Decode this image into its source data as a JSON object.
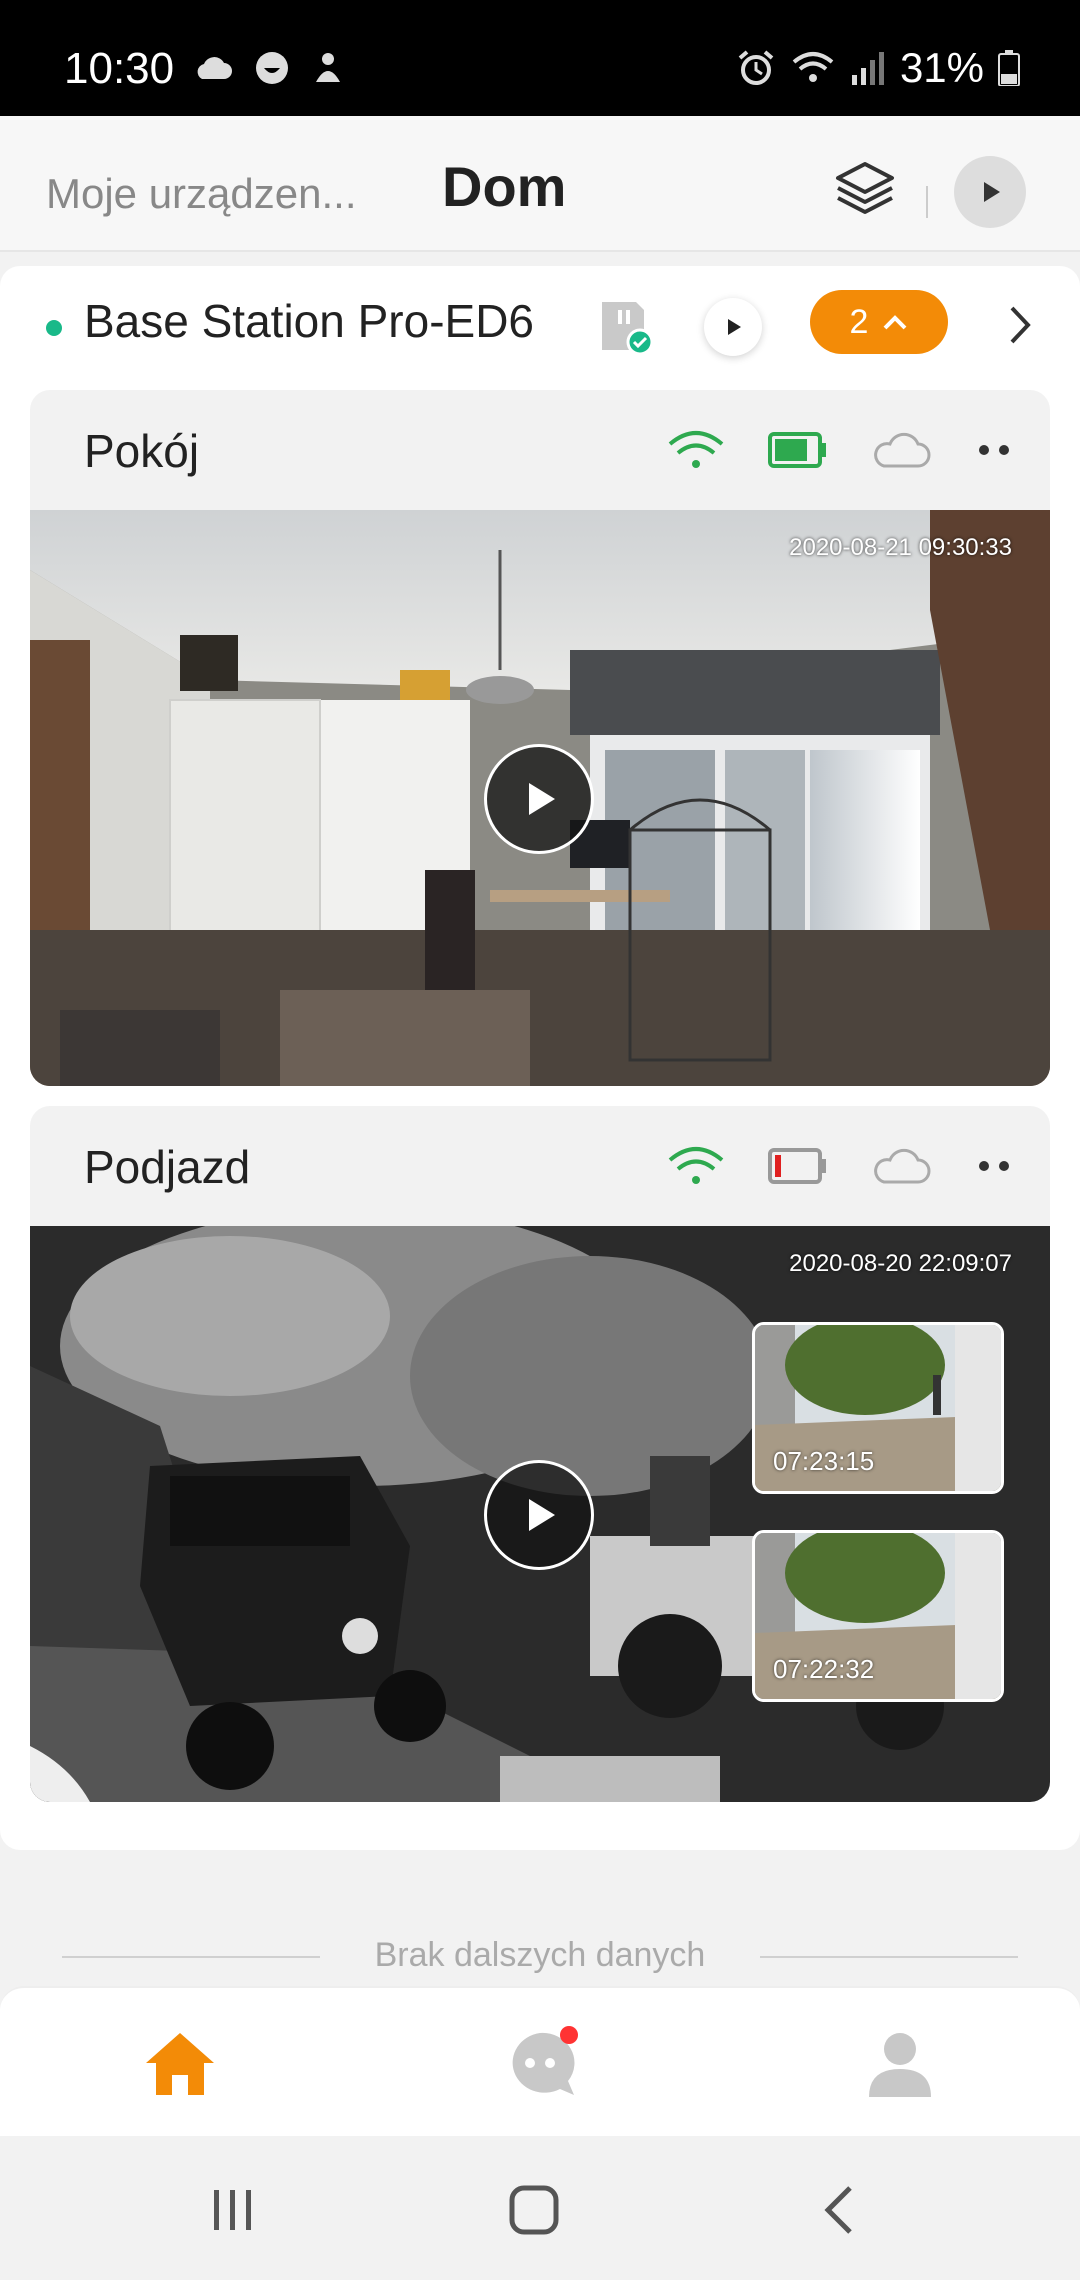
{
  "status_bar": {
    "time": "10:30",
    "battery_percent": "31%",
    "icons": [
      "cloud-icon",
      "smiley-icon",
      "notification-icon",
      "alarm-icon",
      "wifi-icon",
      "signal-icon",
      "battery-icon"
    ]
  },
  "header": {
    "devices_label": "Moje urządzen...",
    "title": "Dom"
  },
  "station": {
    "name": "Base Station Pro-ED6",
    "count": "2",
    "status_color": "#19b989"
  },
  "cameras": [
    {
      "name": "Pokój",
      "timestamp": "2020-08-21 09:30:33",
      "battery_level": 0.8,
      "battery_color": "#2ea94f"
    },
    {
      "name": "Podjazd",
      "timestamp": "2020-08-20 22:09:07",
      "battery_level": 0.15,
      "battery_color": "#e02020",
      "events": [
        {
          "time": "07:23:15"
        },
        {
          "time": "07:22:32"
        }
      ]
    }
  ],
  "footer": {
    "no_more_data": "Brak dalszych danych"
  },
  "bottom_nav": {
    "active": "home",
    "accent_color": "#f38b07",
    "items": [
      "home-icon",
      "messages-icon",
      "profile-icon"
    ]
  }
}
